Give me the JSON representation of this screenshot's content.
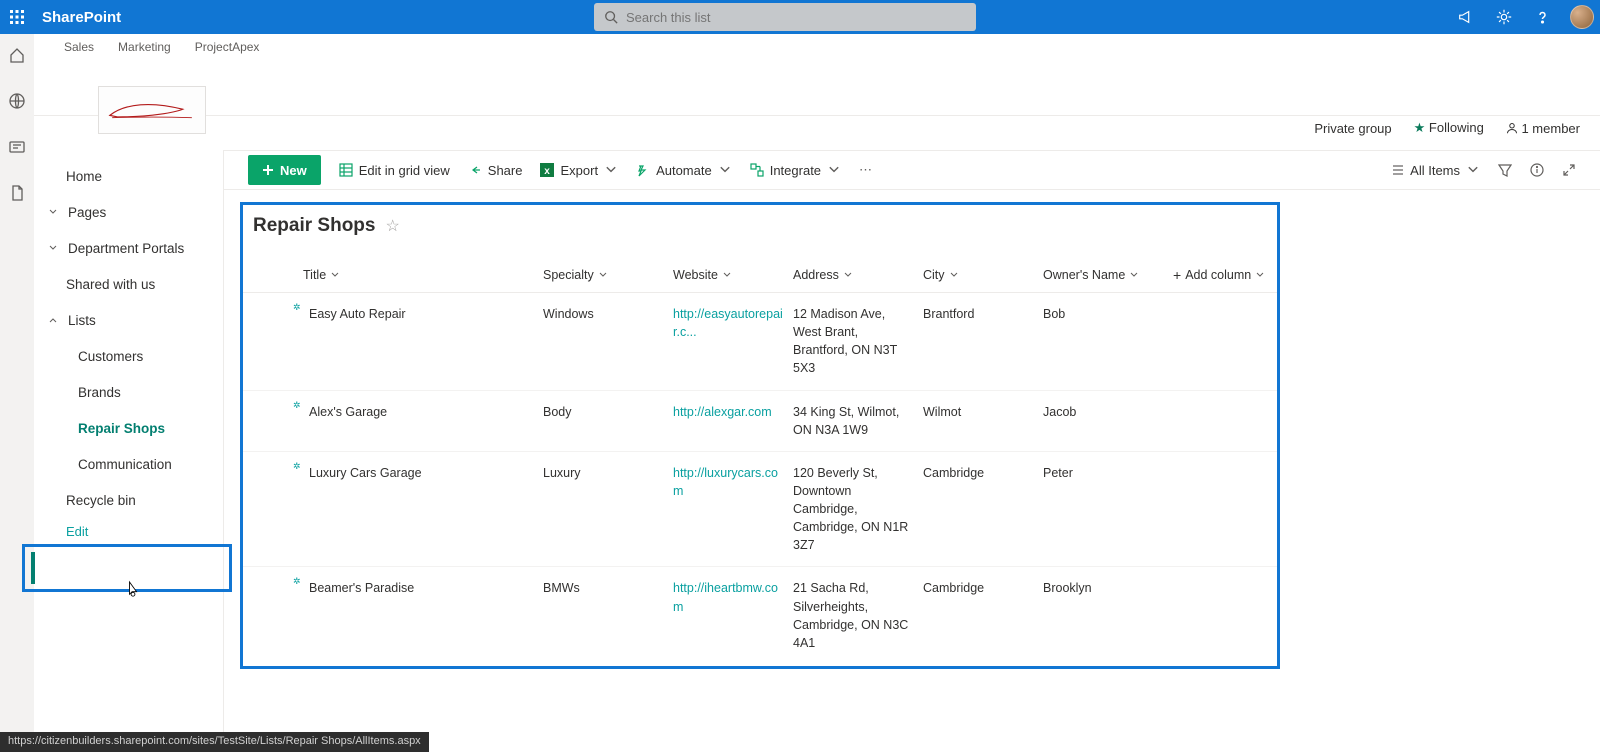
{
  "suite": {
    "brand": "SharePoint",
    "search_placeholder": "Search this list"
  },
  "hub": {
    "links": [
      "Sales",
      "Marketing",
      "ProjectApex"
    ]
  },
  "site_info": {
    "privacy": "Private group",
    "following": "Following",
    "members": "1 member"
  },
  "commands": {
    "new": "New",
    "edit_grid": "Edit in grid view",
    "share": "Share",
    "export": "Export",
    "automate": "Automate",
    "integrate": "Integrate",
    "all_items": "All Items"
  },
  "nav": {
    "home": "Home",
    "pages": "Pages",
    "dept": "Department Portals",
    "shared": "Shared with us",
    "lists": "Lists",
    "lists_children": [
      "Customers",
      "Brands",
      "Repair Shops",
      "Communication"
    ],
    "recycle": "Recycle bin",
    "edit": "Edit"
  },
  "list": {
    "title": "Repair Shops",
    "columns": {
      "title": "Title",
      "specialty": "Specialty",
      "website": "Website",
      "address": "Address",
      "city": "City",
      "owner": "Owner's Name",
      "add": "Add column"
    },
    "rows": [
      {
        "title": "Easy Auto Repair",
        "specialty": "Windows",
        "website": "http://easyautorepair.c...",
        "address": "12 Madison Ave, West Brant, Brantford, ON N3T 5X3",
        "city": "Brantford",
        "owner": "Bob"
      },
      {
        "title": "Alex's Garage",
        "specialty": "Body",
        "website": "http://alexgar.com",
        "address": "34 King St, Wilmot, ON N3A 1W9",
        "city": "Wilmot",
        "owner": "Jacob"
      },
      {
        "title": "Luxury Cars Garage",
        "specialty": "Luxury",
        "website": "http://luxurycars.com",
        "address": "120 Beverly St, Downtown Cambridge, Cambridge, ON N1R 3Z7",
        "city": "Cambridge",
        "owner": "Peter"
      },
      {
        "title": "Beamer's Paradise",
        "specialty": "BMWs",
        "website": "http://iheartbmw.com",
        "address": "21 Sacha Rd, Silverheights, Cambridge, ON N3C 4A1",
        "city": "Cambridge",
        "owner": "Brooklyn"
      }
    ]
  },
  "status_url": "https://citizenbuilders.sharepoint.com/sites/TestSite/Lists/Repair Shops/AllItems.aspx"
}
